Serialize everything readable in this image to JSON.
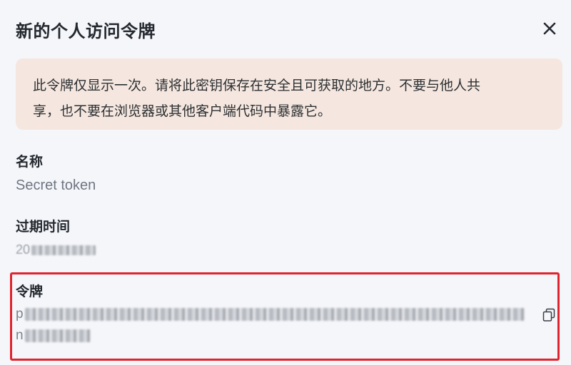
{
  "dialog": {
    "title": "新的个人访问令牌",
    "warning_line1": "此令牌仅显示一次。请将此密钥保存在安全且可获取的地方。不要与他人共",
    "warning_line2": "享，也不要在浏览器或其他客户端代码中暴露它。",
    "name_label": "名称",
    "name_value": "Secret token",
    "expiry_label": "过期时间",
    "expiry_value_visible": "20",
    "token_label": "令牌",
    "token_line1_prefix": "p",
    "token_line2_prefix": "n"
  },
  "icons": {
    "close": "close-icon",
    "copy": "copy-icon"
  },
  "colors": {
    "warning_bg": "#f5e7df",
    "highlight_border": "#e0242f",
    "page_bg": "#f5f6fa"
  }
}
